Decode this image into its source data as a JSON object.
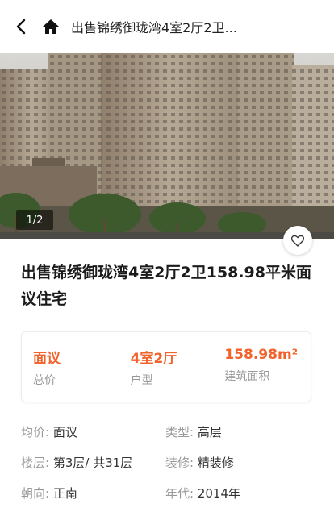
{
  "header": {
    "title": "出售锦绣御珑湾4室2厅2卫..."
  },
  "gallery": {
    "counter": "1/2"
  },
  "listing": {
    "title": "出售锦绣御珑湾4室2厅2卫158.98平米面议住宅"
  },
  "stats": [
    {
      "value": "面议",
      "label": "总价"
    },
    {
      "value": "4室2厅",
      "label": "户型"
    },
    {
      "value": "158.98m²",
      "label": "建筑面积"
    }
  ],
  "details": [
    [
      {
        "key": "均价:",
        "value": "面议"
      },
      {
        "key": "类型:",
        "value": "高层"
      }
    ],
    [
      {
        "key": "楼层:",
        "value": "第3层/ 共31层"
      },
      {
        "key": "装修:",
        "value": "精装修"
      }
    ],
    [
      {
        "key": "朝向:",
        "value": "正南"
      },
      {
        "key": "年代:",
        "value": "2014年"
      }
    ]
  ],
  "colors": {
    "accent": "#f0632b",
    "label": "#999999"
  },
  "icons": [
    "back-arrow-icon",
    "home-icon",
    "heart-icon"
  ]
}
